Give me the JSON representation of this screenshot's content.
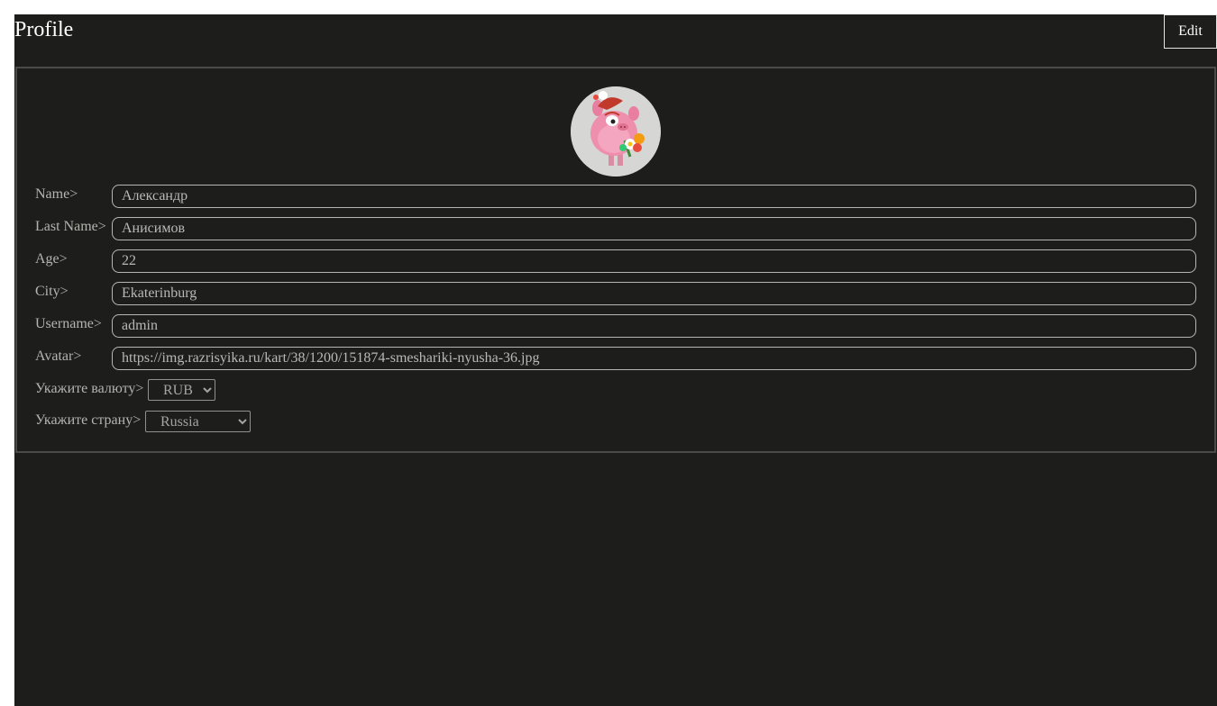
{
  "header": {
    "title": "Profile",
    "edit_label": "Edit"
  },
  "avatar": {
    "alt": "Nyusha (Smeshariki) avatar"
  },
  "fields": {
    "name": {
      "label": "Name>",
      "value": "Александр"
    },
    "last_name": {
      "label": "Last Name>",
      "value": "Анисимов"
    },
    "age": {
      "label": "Age>",
      "value": "22"
    },
    "city": {
      "label": "City>",
      "value": "Ekaterinburg"
    },
    "username": {
      "label": "Username>",
      "value": "admin"
    },
    "avatar_url": {
      "label": "Avatar>",
      "value": "https://img.razrisyika.ru/kart/38/1200/151874-smeshariki-nyusha-36.jpg"
    }
  },
  "currency": {
    "label": "Укажите валюту>",
    "selected": "RUB"
  },
  "country": {
    "label": "Укажите страну>",
    "selected": "Russia"
  },
  "colors": {
    "background": "#1d1e1b",
    "text": "#ffffff",
    "muted_text": "#b4b4b0",
    "input_border": "#b6b6b2"
  }
}
